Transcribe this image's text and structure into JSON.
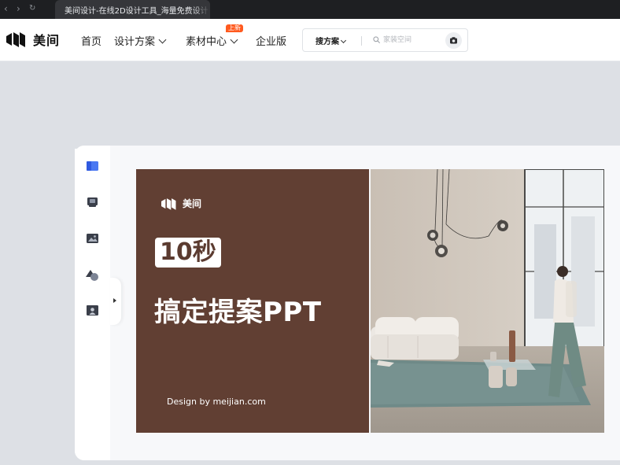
{
  "browser": {
    "tab_title": "美间设计-在线2D设计工具_海量免费设计"
  },
  "header": {
    "logo_text": "美间",
    "nav": [
      {
        "label": "首页",
        "has_dropdown": false
      },
      {
        "label": "设计方案",
        "has_dropdown": true
      },
      {
        "label": "素材中心",
        "has_dropdown": true,
        "badge": "上新"
      },
      {
        "label": "企业版",
        "has_dropdown": false
      }
    ],
    "search": {
      "scope_label": "搜方案",
      "placeholder": "家装空间",
      "value": ""
    }
  },
  "tool_rail": {
    "items": [
      {
        "icon": "template-icon",
        "active": true
      },
      {
        "icon": "layout-icon",
        "active": false
      },
      {
        "icon": "image-icon",
        "active": false
      },
      {
        "icon": "shapes-icon",
        "active": false
      },
      {
        "icon": "person-image-icon",
        "active": false
      }
    ]
  },
  "slide": {
    "logo_text": "美间",
    "highlight_text": "10秒",
    "title": "搞定提案PPT",
    "byline": "Design by meijian.com",
    "photo_icon": "interior-photo"
  },
  "colors": {
    "slide_brown": "#613f33",
    "badge_orange": "#ff5a1f",
    "active_blue": "#3b6df0"
  }
}
